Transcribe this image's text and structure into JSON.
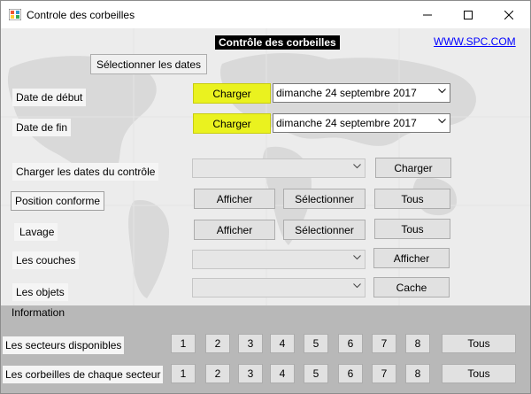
{
  "window": {
    "title": "Controle des corbeilles"
  },
  "header": {
    "title": "Contrôle des corbeilles",
    "link": "WWW.SPC.COM"
  },
  "dates": {
    "select_label": "Sélectionner les dates",
    "start_label": "Date de début",
    "end_label": "Date de fin",
    "load_label": "Charger",
    "start_value": "dimanche 24 septembre 2017",
    "end_value": "dimanche 24 septembre 2017"
  },
  "controls": {
    "load_dates_label": "Charger les dates du contrôle",
    "load_button": "Charger",
    "position_label": "Position conforme",
    "lavage_label": "Lavage",
    "couches_label": "Les couches",
    "objets_label": "Les objets",
    "afficher": "Afficher",
    "selectionner": "Sélectionner",
    "tous": "Tous",
    "cache": "Cache"
  },
  "info": {
    "title": "Information",
    "sectors_label": "Les secteurs disponibles",
    "bins_label": "Les corbeilles de chaque secteur",
    "numbers": [
      "1",
      "2",
      "3",
      "4",
      "5",
      "6",
      "7",
      "8"
    ],
    "tous": "Tous"
  },
  "colors": {
    "highlight": "#eaf21f",
    "link": "#0000ff",
    "panel": "#b8b8b8"
  }
}
